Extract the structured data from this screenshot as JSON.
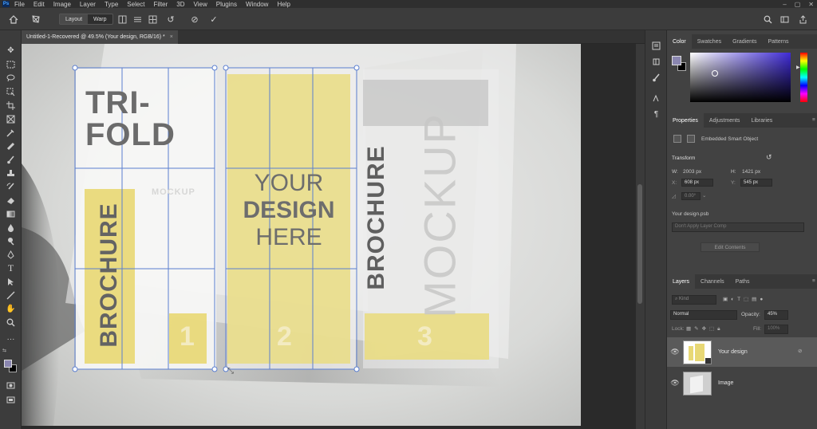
{
  "menu": [
    "File",
    "Edit",
    "Image",
    "Layer",
    "Type",
    "Select",
    "Filter",
    "3D",
    "View",
    "Plugins",
    "Window",
    "Help"
  ],
  "app_icon": "Ps",
  "options": {
    "mode_layout": "Layout",
    "mode_warp": "Warp"
  },
  "tab": {
    "title": "Untitled-1-Recovered @ 49.5% (Your design, RGB/16) *",
    "close": "×"
  },
  "doc": {
    "trifold_line1": "TRI-",
    "trifold_line2": "FOLD",
    "mockup_small": "MOCKUP",
    "brochure": "BROCHURE",
    "your": "YOUR",
    "design": "DESIGN",
    "here": "HERE",
    "mockup_large": "MOCKUP",
    "num1": "1",
    "num2": "2",
    "num3": "3"
  },
  "color_panel": {
    "tabs": [
      "Color",
      "Swatches",
      "Gradients",
      "Patterns"
    ],
    "fg": "#8a86b0",
    "bg": "#000000"
  },
  "properties": {
    "tabs": [
      "Properties",
      "Adjustments",
      "Libraries"
    ],
    "object_type": "Embedded Smart Object",
    "transform_label": "Transform",
    "w_label": "W:",
    "w_value": "2003 px",
    "h_label": "H:",
    "h_value": "1421 px",
    "x_label": "X:",
    "x_value": "608 px",
    "y_label": "Y:",
    "y_value": "545 px",
    "angle_value": "0.00°",
    "file": "Your design.psb",
    "comp_placeholder": "Don't Apply Layer Comp",
    "edit_contents": "Edit Contents"
  },
  "layers": {
    "tabs": [
      "Layers",
      "Channels",
      "Paths"
    ],
    "filter_placeholder": "Kind",
    "blend_mode": "Normal",
    "opacity_label": "Opacity:",
    "opacity_value": "45%",
    "lock_label": "Lock:",
    "fill_label": "Fill:",
    "fill_value": "100%",
    "items": [
      {
        "name": "Your design"
      },
      {
        "name": "Image"
      }
    ]
  },
  "colors": {
    "accent_yellow": "#e6d97a",
    "selection_blue": "#5b7fd0"
  }
}
